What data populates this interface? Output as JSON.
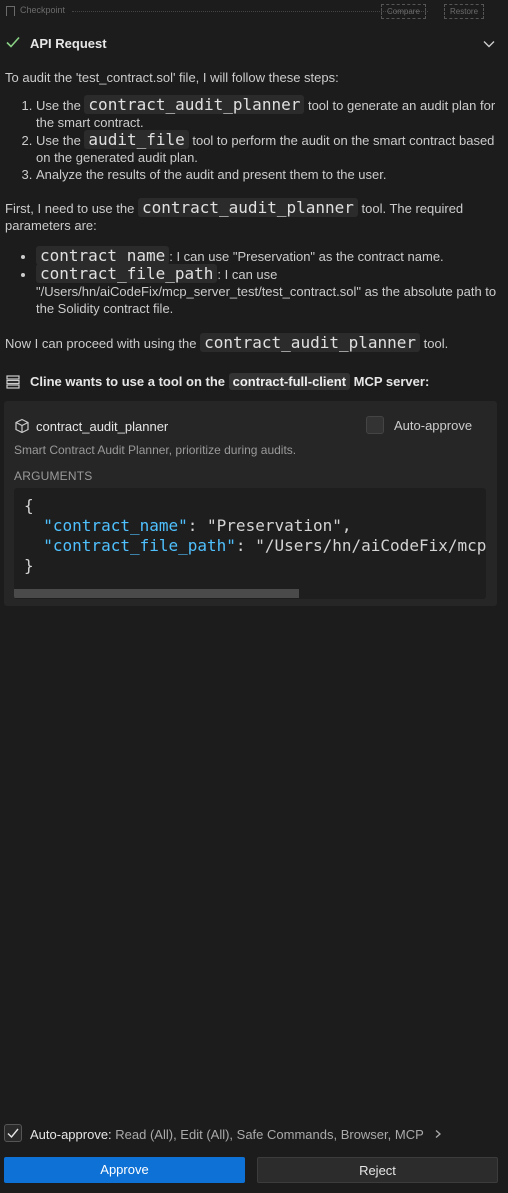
{
  "checkpoint": {
    "label": "Checkpoint",
    "compare_label": "Compare",
    "restore_label": "Restore"
  },
  "header": {
    "title": "API Request"
  },
  "message": {
    "intro": "To audit the 'test_contract.sol' file, I will follow these steps:",
    "steps": [
      {
        "pre": "Use the ",
        "code": "contract_audit_planner",
        "post": " tool to generate an audit plan for the smart contract."
      },
      {
        "pre": "Use the ",
        "code": "audit_file",
        "post": " tool to perform the audit on the smart contract based on the generated audit plan."
      },
      {
        "text": "Analyze the results of the audit and present them to the user."
      }
    ],
    "first_pre": "First, I need to use the ",
    "first_code": "contract_audit_planner",
    "first_post": " tool. The required parameters are:",
    "params": [
      {
        "code": "contract_name",
        "post": ": I can use \"Preservation\" as the contract name."
      },
      {
        "code": "contract_file_path",
        "post": ": I can use \"/Users/hn/aiCodeFix/mcp_server_test/test_contract.sol\" as the absolute path to the Solidity contract file."
      }
    ],
    "proceed_pre": "Now I can proceed with using the ",
    "proceed_code": "contract_audit_planner",
    "proceed_post": " tool."
  },
  "tool_use": {
    "prefix": "Cline wants to use a tool on the ",
    "server": "contract-full-client",
    "suffix": " MCP server:"
  },
  "tool_panel": {
    "tool_name": "contract_audit_planner",
    "auto_approve_label": "Auto-approve",
    "description": "Smart Contract Audit Planner, prioritize during audits.",
    "arguments_label": "ARGUMENTS",
    "code": {
      "open": "{",
      "k1": "\"contract_name\"",
      "v1": ": \"Preservation\",",
      "k2": "\"contract_file_path\"",
      "v2": ": \"/Users/hn/aiCodeFix/mcp",
      "close": "}"
    }
  },
  "footer": {
    "auto_approve_label": "Auto-approve:",
    "auto_approve_detail": " Read (All), Edit (All), Safe Commands, Browser, MCP",
    "approve_label": "Approve",
    "reject_label": "Reject"
  },
  "colors": {
    "accent": "#0e71d6",
    "check": "#89d185",
    "key": "#4fc1ff"
  }
}
